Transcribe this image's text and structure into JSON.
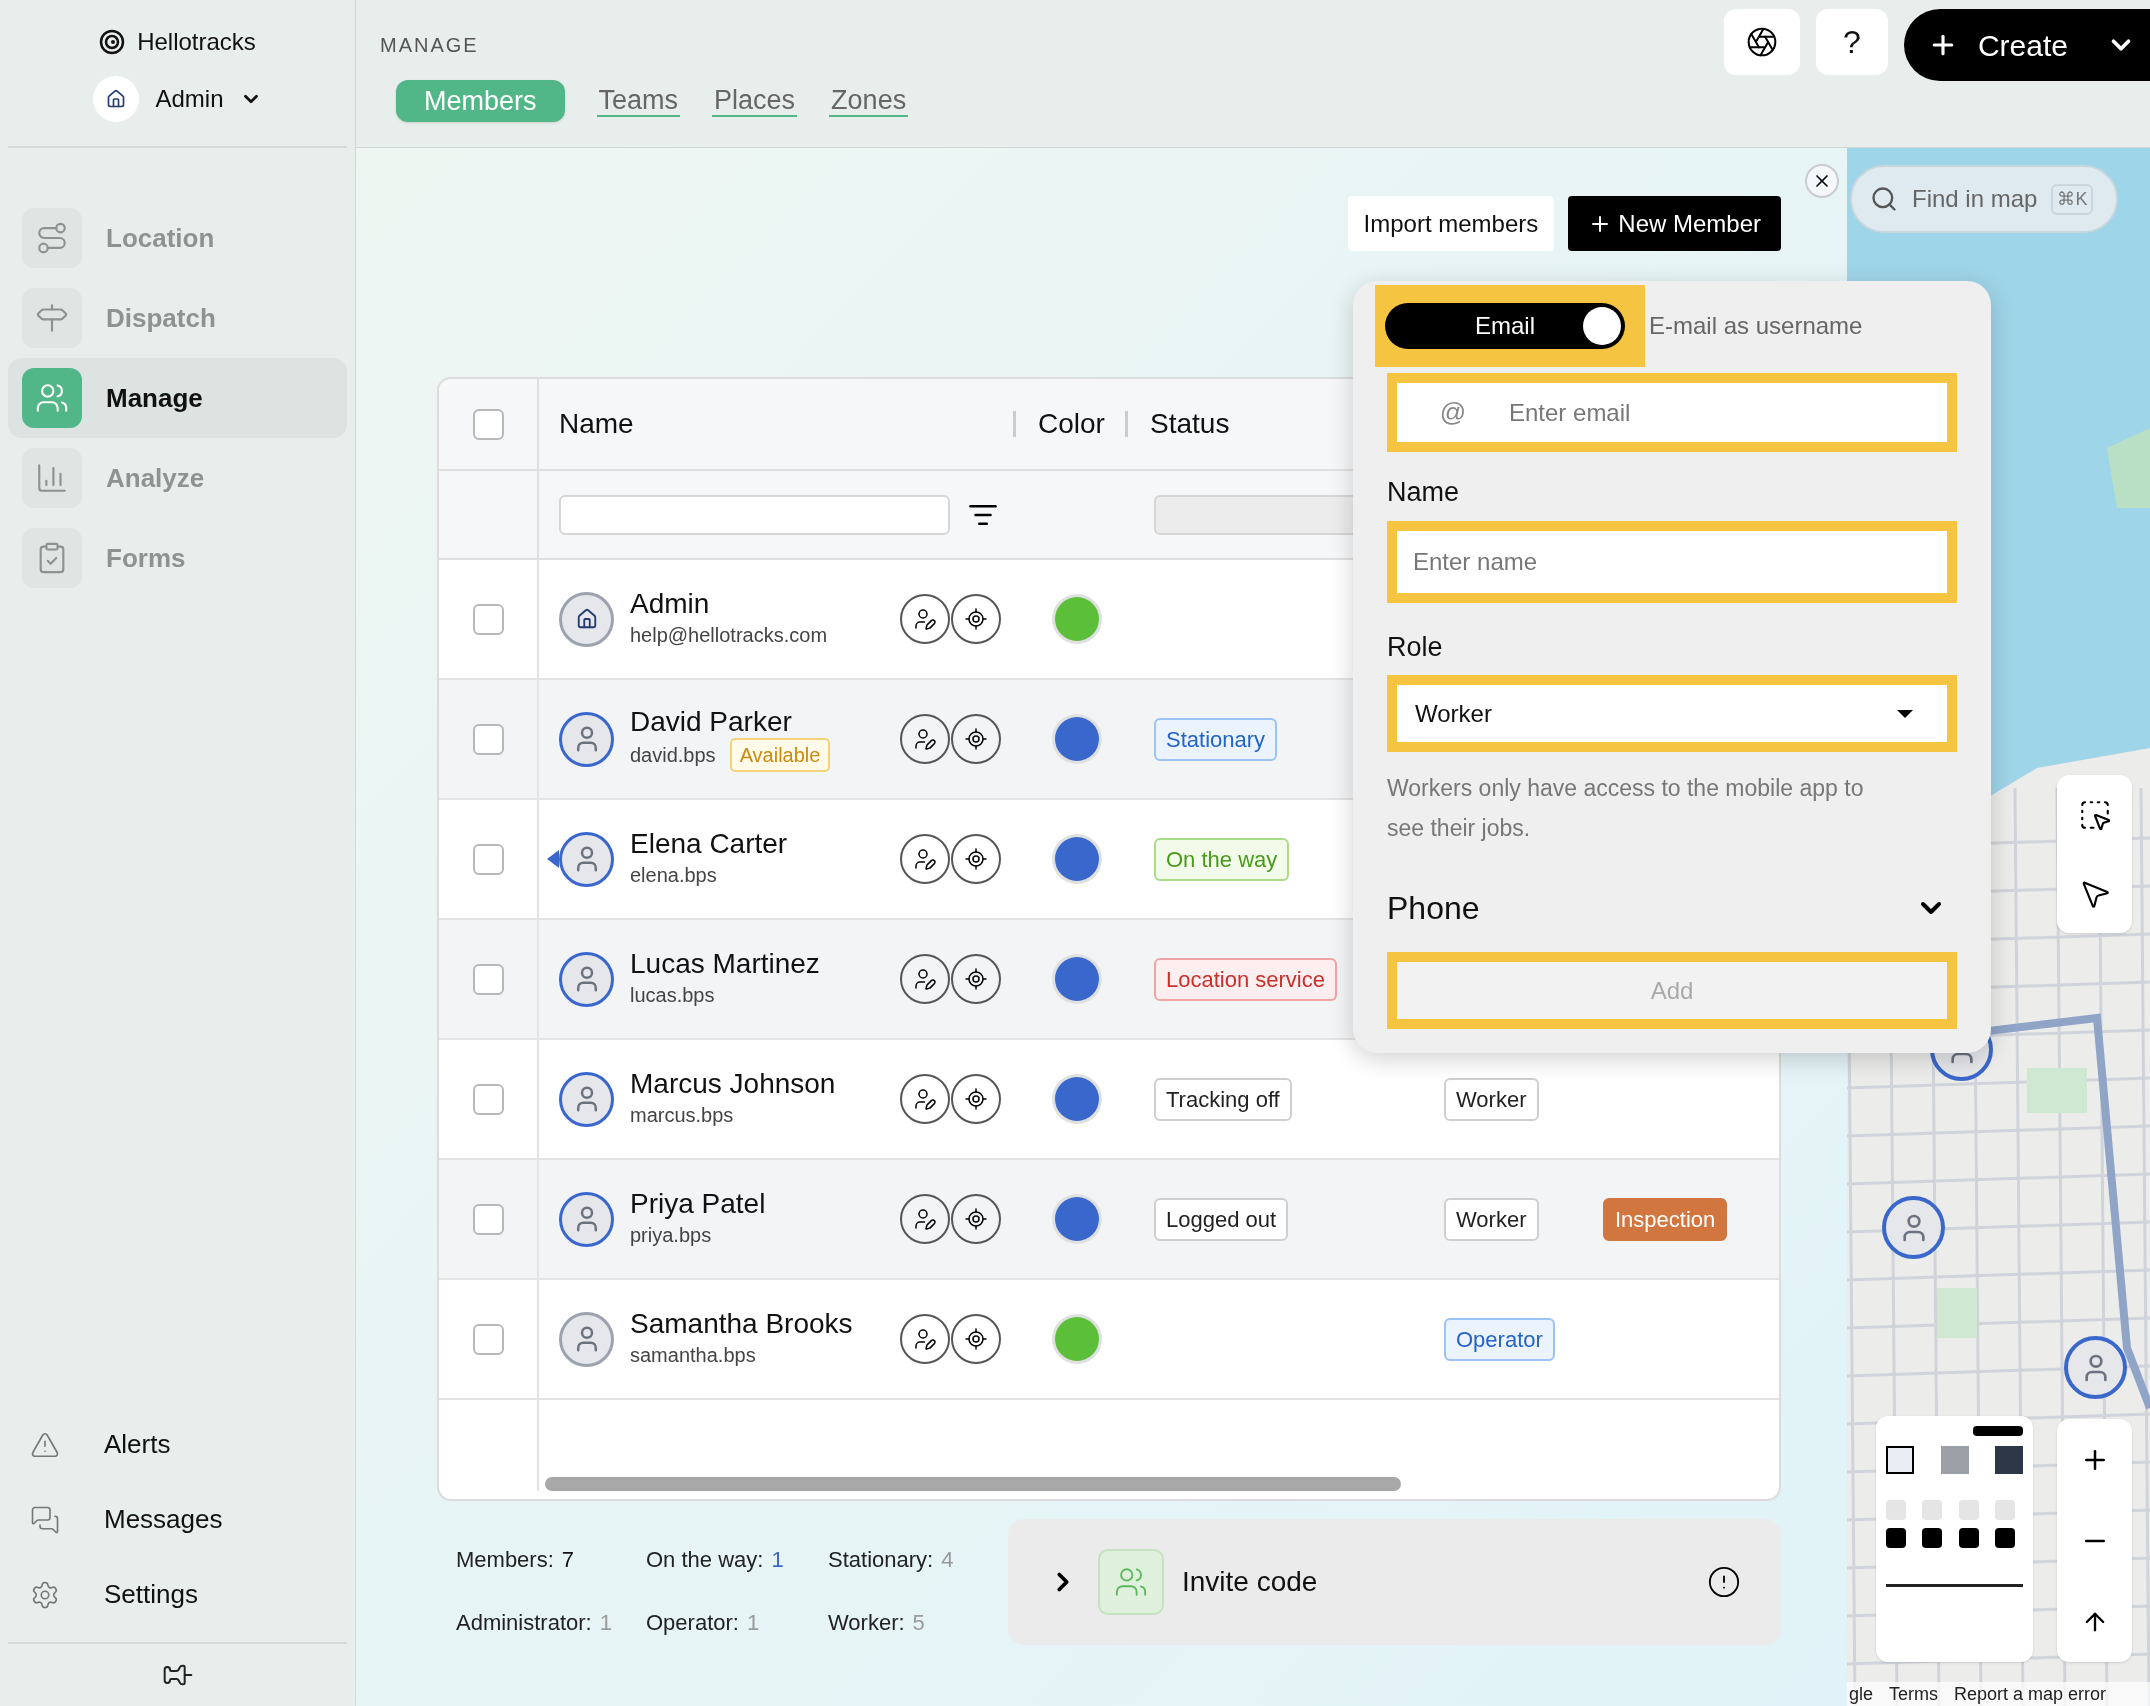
{
  "sidebar": {
    "brand": "Hellotracks",
    "account": "Admin",
    "nav": [
      {
        "label": "Location",
        "selected": false
      },
      {
        "label": "Dispatch",
        "selected": false
      },
      {
        "label": "Manage",
        "selected": true
      },
      {
        "label": "Analyze",
        "selected": false
      },
      {
        "label": "Forms",
        "selected": false
      }
    ],
    "bottom": [
      {
        "label": "Alerts"
      },
      {
        "label": "Messages"
      },
      {
        "label": "Settings"
      }
    ]
  },
  "header": {
    "section": "MANAGE",
    "tabs": [
      {
        "label": "Members",
        "selected": true
      },
      {
        "label": "Teams",
        "selected": false
      },
      {
        "label": "Places",
        "selected": false
      },
      {
        "label": "Zones",
        "selected": false
      }
    ],
    "help": "?",
    "create": "Create"
  },
  "toolbar": {
    "import": "Import members",
    "new_member": "New Member"
  },
  "table": {
    "all_checked": false,
    "columns": [
      "Name",
      "Color",
      "Status"
    ],
    "rows": [
      {
        "name": "Admin",
        "sub": "help@hellotracks.com",
        "kind": "logo",
        "pointer": false,
        "checked": false,
        "color": "#5cbf3a"
      },
      {
        "name": "David Parker",
        "sub": "david.bps",
        "availability": "Available",
        "kind": "tracked",
        "pointer": false,
        "checked": false,
        "color": "#3a67cc",
        "status": {
          "label": "Stationary",
          "kind": "blue"
        }
      },
      {
        "name": "Elena Carter",
        "sub": "elena.bps",
        "kind": "tracked",
        "pointer": true,
        "checked": false,
        "color": "#3a67cc",
        "status": {
          "label": "On the way",
          "kind": "green"
        }
      },
      {
        "name": "Lucas Martinez",
        "sub": "lucas.bps",
        "kind": "tracked",
        "pointer": false,
        "checked": false,
        "color": "#3a67cc",
        "status": {
          "label": "Location service",
          "kind": "red"
        }
      },
      {
        "name": "Marcus Johnson",
        "sub": "marcus.bps",
        "kind": "tracked",
        "pointer": false,
        "checked": false,
        "color": "#3a67cc",
        "status": {
          "label": "Tracking off",
          "kind": "neutral"
        },
        "role": {
          "label": "Worker",
          "kind": "neutral"
        }
      },
      {
        "name": "Priya Patel",
        "sub": "priya.bps",
        "kind": "tracked",
        "pointer": false,
        "checked": false,
        "color": "#3a67cc",
        "status": {
          "label": "Logged out",
          "kind": "neutral"
        },
        "role": {
          "label": "Worker",
          "kind": "neutral"
        },
        "job": {
          "label": "Inspection",
          "kind": "orange"
        }
      },
      {
        "name": "Samantha Brooks",
        "sub": "samantha.bps",
        "kind": "untracked",
        "pointer": false,
        "checked": false,
        "color": "#5cbf3a",
        "role": {
          "label": "Operator",
          "kind": "blue"
        }
      }
    ]
  },
  "stats": [
    {
      "label": "Members:",
      "value": "7",
      "color": "#111111"
    },
    {
      "label": "On the way:",
      "value": "1",
      "color": "#3a67cc"
    },
    {
      "label": "Stationary:",
      "value": "4",
      "color": "#9a9a9a"
    },
    {
      "label": "Administrator:",
      "value": "1",
      "color": "#9a9a9a"
    },
    {
      "label": "Operator:",
      "value": "1",
      "color": "#9a9a9a"
    },
    {
      "label": "Worker:",
      "value": "5",
      "color": "#9a9a9a"
    }
  ],
  "invite": {
    "label": "Invite code"
  },
  "form": {
    "toggle": {
      "label": "Email",
      "on": true
    },
    "toggle_caption": "E-mail as username",
    "email": {
      "prefix": "@",
      "placeholder": "Enter email"
    },
    "name_label": "Name",
    "name": {
      "placeholder": "Enter name"
    },
    "role_label": "Role",
    "role": {
      "value": "Worker"
    },
    "help": "Workers only have access to the mobile app to see their jobs.",
    "phone_label": "Phone",
    "phone_expanded": true,
    "add": {
      "label": "Add",
      "disabled": true
    }
  },
  "map": {
    "search": {
      "placeholder": "Find in map",
      "shortcut": "⌘K"
    },
    "attribution": [
      "gle",
      "Terms",
      "Report a map error"
    ]
  }
}
